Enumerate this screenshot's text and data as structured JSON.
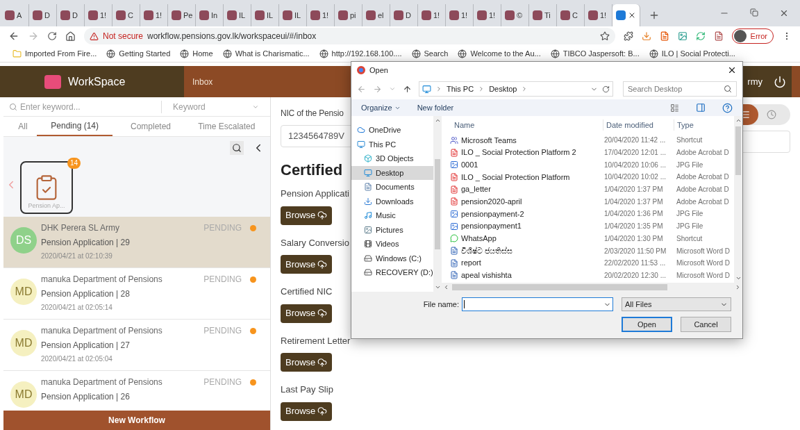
{
  "browser": {
    "tabs": [
      {
        "label": "A",
        "selected": false
      },
      {
        "label": "D",
        "selected": false
      },
      {
        "label": "D",
        "selected": false
      },
      {
        "label": "1!",
        "selected": false
      },
      {
        "label": "C",
        "selected": false
      },
      {
        "label": "1!",
        "selected": false
      },
      {
        "label": "Pe",
        "selected": false
      },
      {
        "label": "In",
        "selected": false
      },
      {
        "label": "IL",
        "selected": false
      },
      {
        "label": "IL",
        "selected": false
      },
      {
        "label": "IL",
        "selected": false
      },
      {
        "label": "1!",
        "selected": false
      },
      {
        "label": "pi",
        "selected": false
      },
      {
        "label": "el",
        "selected": false
      },
      {
        "label": "D",
        "selected": false
      },
      {
        "label": "1!",
        "selected": false
      },
      {
        "label": "1!",
        "selected": false
      },
      {
        "label": "1!",
        "selected": false
      },
      {
        "label": "©",
        "selected": false
      },
      {
        "label": "Ti",
        "selected": false
      },
      {
        "label": "C",
        "selected": false
      },
      {
        "label": "1!",
        "selected": false
      },
      {
        "selected": true
      }
    ],
    "warning": "Not secure",
    "url": "workflow.pensions.gov.lk/workspaceui/#/inbox",
    "profile": "Error",
    "bookmarks": [
      "Imported From Fire...",
      "Getting Started",
      "Home",
      "What is Charismatic...",
      "http://192.168.100....",
      "Search",
      "Welcome to the Au...",
      "TIBCO Jaspersoft: B...",
      "ILO | Social Protecti..."
    ]
  },
  "app": {
    "brand": "WorkSpace",
    "nav": "Inbox",
    "user": "rmy",
    "search_placeholder": "Enter keyword...",
    "filter": "Keyword",
    "filter_tabs": [
      {
        "label": "All",
        "selected": false
      },
      {
        "label": "Pending (14)",
        "selected": true
      },
      {
        "label": "Completed",
        "selected": false
      },
      {
        "label": "Time Escalated",
        "selected": false
      }
    ],
    "workflow_card": {
      "label": "Pension Ap...",
      "badge": "14"
    },
    "items": [
      {
        "initials": "DS",
        "name": "DHK Perera SL Army",
        "status": "PENDING",
        "title": "Pension Application | 29",
        "date": "2020/04/21 at 02:10:39",
        "color": "#8fd18a",
        "selected": true
      },
      {
        "initials": "MD",
        "name": "manuka Department of Pensions",
        "status": "PENDING",
        "title": "Pension Application | 28",
        "date": "2020/04/21 at 02:05:14",
        "color": "#f5f0c0",
        "selected": false
      },
      {
        "initials": "MD",
        "name": "manuka Department of Pensions",
        "status": "PENDING",
        "title": "Pension Application | 27",
        "date": "2020/04/21 at 02:05:04",
        "color": "#f5f0c0",
        "selected": false
      },
      {
        "initials": "MD",
        "name": "manuka Department of Pensions",
        "status": "PENDING",
        "title": "Pension Application | 26",
        "color": "#f5f0c0",
        "selected": false
      }
    ],
    "view_toggle": [
      {
        "kind": "list",
        "selected": true
      },
      {
        "kind": "clock",
        "selected": false
      }
    ],
    "new_workflow": "New Workflow",
    "form": {
      "nic_label": "NIC of the Pensio",
      "nic_value": "1234564789V",
      "heading": "Certified",
      "fields": [
        {
          "label": "Pension Applicati",
          "button": "Browse"
        },
        {
          "label": "Salary Conversio",
          "button": "Browse"
        },
        {
          "label": "Certified NIC",
          "button": "Browse"
        },
        {
          "label": "Retirement Letter",
          "button": "Browse"
        },
        {
          "label": "Last Pay Slip",
          "button": "Browse"
        }
      ]
    }
  },
  "dialog": {
    "title": "Open",
    "path": [
      "This PC",
      "Desktop"
    ],
    "search_placeholder": "Search Desktop",
    "organize": "Organize",
    "new_folder": "New folder",
    "nav": [
      {
        "label": "OneDrive",
        "kind": "cloud",
        "selected": false
      },
      {
        "label": "This PC",
        "kind": "pc",
        "selected": false
      },
      {
        "label": "3D Objects",
        "kind": "cube",
        "selected": false
      },
      {
        "label": "Desktop",
        "kind": "desktop",
        "selected": true
      },
      {
        "label": "Documents",
        "kind": "doc",
        "selected": false
      },
      {
        "label": "Downloads",
        "kind": "download",
        "selected": false
      },
      {
        "label": "Music",
        "kind": "music",
        "selected": false
      },
      {
        "label": "Pictures",
        "kind": "picture",
        "selected": false
      },
      {
        "label": "Videos",
        "kind": "video",
        "selected": false
      },
      {
        "label": "Windows (C:)",
        "kind": "drive",
        "selected": false
      },
      {
        "label": "RECOVERY (D:)",
        "kind": "drive",
        "selected": false
      }
    ],
    "columns": [
      "Name",
      "Date modified",
      "Type"
    ],
    "files": [
      {
        "name": "Microsoft Teams",
        "date": "20/04/2020 11:42 ...",
        "type": "Shortcut",
        "kind": "teams"
      },
      {
        "name": "ILO _ Social Protection Platform 2",
        "date": "17/04/2020 12:01 ...",
        "type": "Adobe Acrobat D",
        "kind": "pdf"
      },
      {
        "name": "0001",
        "date": "10/04/2020 10:06 ...",
        "type": "JPG File",
        "kind": "jpg"
      },
      {
        "name": "ILO _ Social Protection Platform",
        "date": "10/04/2020 10:02 ...",
        "type": "Adobe Acrobat D",
        "kind": "pdf"
      },
      {
        "name": "ga_letter",
        "date": "1/04/2020 1:37 PM",
        "type": "Adobe Acrobat D",
        "kind": "pdf"
      },
      {
        "name": "pension2020-april",
        "date": "1/04/2020 1:37 PM",
        "type": "Adobe Acrobat D",
        "kind": "pdf"
      },
      {
        "name": "pensionpayment-2",
        "date": "1/04/2020 1:36 PM",
        "type": "JPG File",
        "kind": "jpg"
      },
      {
        "name": "pensionpayment1",
        "date": "1/04/2020 1:35 PM",
        "type": "JPG File",
        "kind": "jpg"
      },
      {
        "name": "WhatsApp",
        "date": "1/04/2020 1:30 PM",
        "type": "Shortcut",
        "kind": "whatsapp"
      },
      {
        "name": "විශිෂ්ට ජයතිස්ස",
        "date": "2/03/2020 11:50 PM",
        "type": "Microsoft Word D",
        "kind": "word"
      },
      {
        "name": "report",
        "date": "22/02/2020 11:53 ...",
        "type": "Microsoft Word D",
        "kind": "word"
      },
      {
        "name": "apeal vishishta",
        "date": "20/02/2020 12:30 ...",
        "type": "Microsoft Word D",
        "kind": "word"
      }
    ],
    "file_name_label": "File name:",
    "filter": "All Files",
    "open": "Open",
    "cancel": "Cancel"
  }
}
